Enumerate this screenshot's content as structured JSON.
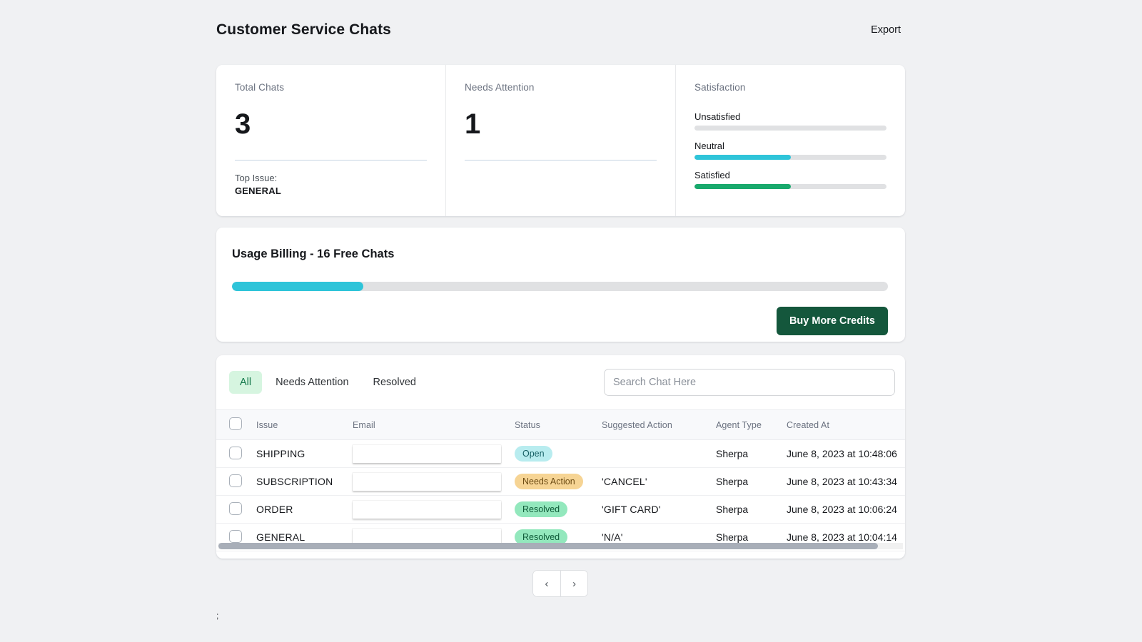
{
  "header": {
    "title": "Customer Service Chats",
    "export_label": "Export"
  },
  "stats": {
    "total": {
      "label": "Total Chats",
      "value": "3",
      "sub_label": "Top Issue:",
      "sub_value": "GENERAL"
    },
    "needs_attention": {
      "label": "Needs Attention",
      "value": "1"
    },
    "satisfaction": {
      "label": "Satisfaction",
      "items": [
        {
          "name": "Unsatisfied",
          "percent": 0,
          "color": "#e0e1e3"
        },
        {
          "name": "Neutral",
          "percent": 50,
          "color": "#2ec4d9"
        },
        {
          "name": "Satisfied",
          "percent": 50,
          "color": "#18a96c"
        }
      ]
    }
  },
  "usage": {
    "title": "Usage Billing - 16 Free Chats",
    "progress_percent": 20,
    "progress_color": "#2ec4d9",
    "buy_label": "Buy More Credits",
    "buy_color": "#14573c"
  },
  "table": {
    "tabs": [
      {
        "label": "All",
        "active": true
      },
      {
        "label": "Needs Attention",
        "active": false
      },
      {
        "label": "Resolved",
        "active": false
      }
    ],
    "search_placeholder": "Search Chat Here",
    "search_value": "",
    "columns": [
      "Issue",
      "Email",
      "Status",
      "Suggested Action",
      "Agent Type",
      "Created At"
    ],
    "rows": [
      {
        "issue": "SHIPPING",
        "email": "",
        "status": "Open",
        "status_kind": "open",
        "suggested_action": "",
        "agent_type": "Sherpa",
        "created_at": "June 8, 2023 at 10:48:06"
      },
      {
        "issue": "SUBSCRIPTION",
        "email": "",
        "status": "Needs Action",
        "status_kind": "needsaction",
        "suggested_action": "'CANCEL'",
        "agent_type": "Sherpa",
        "created_at": "June 8, 2023 at 10:43:34"
      },
      {
        "issue": "ORDER",
        "email": "",
        "status": "Resolved",
        "status_kind": "resolved",
        "suggested_action": "'GIFT CARD'",
        "agent_type": "Sherpa",
        "created_at": "June 8, 2023 at 10:06:24"
      },
      {
        "issue": "GENERAL",
        "email": "",
        "status": "Resolved",
        "status_kind": "resolved",
        "suggested_action": "'N/A'",
        "agent_type": "Sherpa",
        "created_at": "June 8, 2023 at 10:04:14"
      }
    ]
  },
  "pagination": {
    "prev_label": "‹",
    "next_label": "›"
  },
  "footer": {
    "stray_text": ";"
  }
}
